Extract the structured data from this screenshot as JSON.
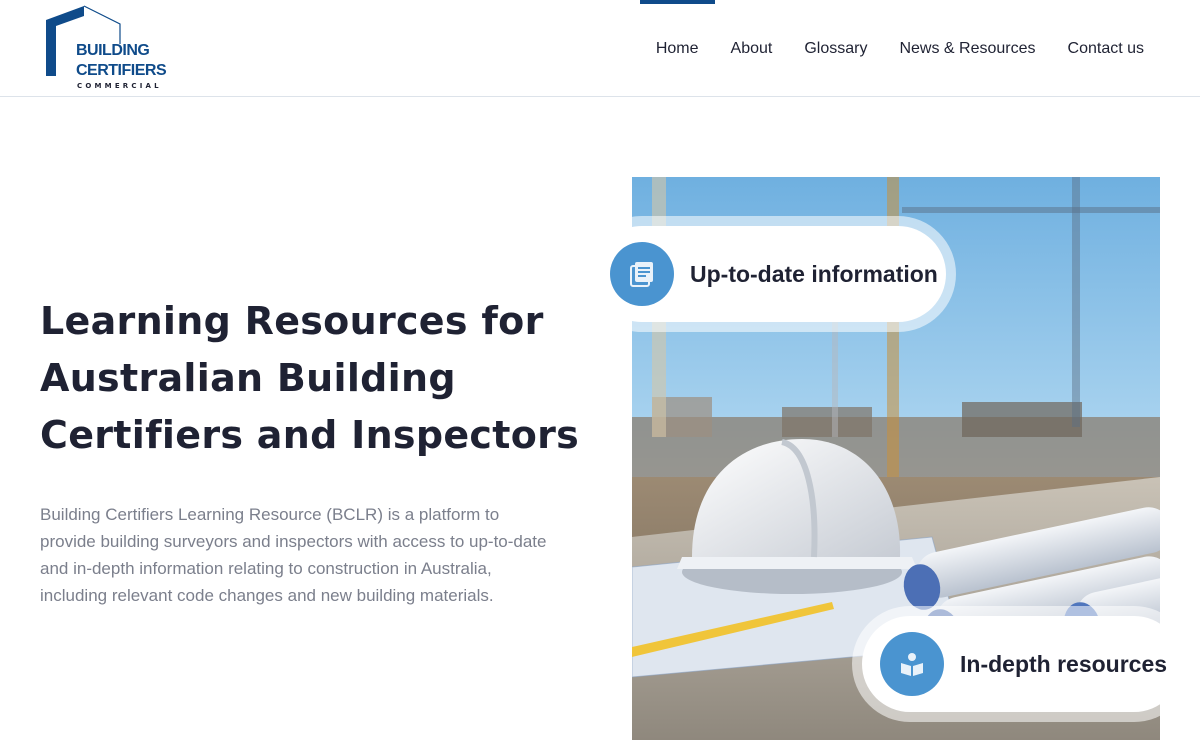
{
  "logo": {
    "line1": "BUILDING",
    "line2": "CERTIFIERS",
    "line3": "COMMERCIAL",
    "mark_icon": "house-outline-icon",
    "brand_color": "#0f4b8a"
  },
  "nav": {
    "items": [
      {
        "label": "Home",
        "active": true
      },
      {
        "label": "About",
        "active": false
      },
      {
        "label": "Glossary",
        "active": false
      },
      {
        "label": "News & Resources",
        "active": false
      },
      {
        "label": "Contact us",
        "active": false
      }
    ]
  },
  "hero": {
    "title_lines": [
      "Learning Resources for",
      "Australian Building",
      "Certifiers and Inspectors"
    ],
    "description": "Building Certifiers Learning Resource (BCLR) is a platform to provide building surveyors and inspectors with access to up-to-date and in-depth information relating to construction in Australia, including relevant code changes and new building materials."
  },
  "badges": [
    {
      "label": "Up-to-date information",
      "icon": "document-list-icon"
    },
    {
      "label": "In-depth resources",
      "icon": "open-book-icon"
    }
  ],
  "colors": {
    "accent": "#4a94d0",
    "text_dark": "#1f2233",
    "text_muted": "#7b7f8c"
  }
}
